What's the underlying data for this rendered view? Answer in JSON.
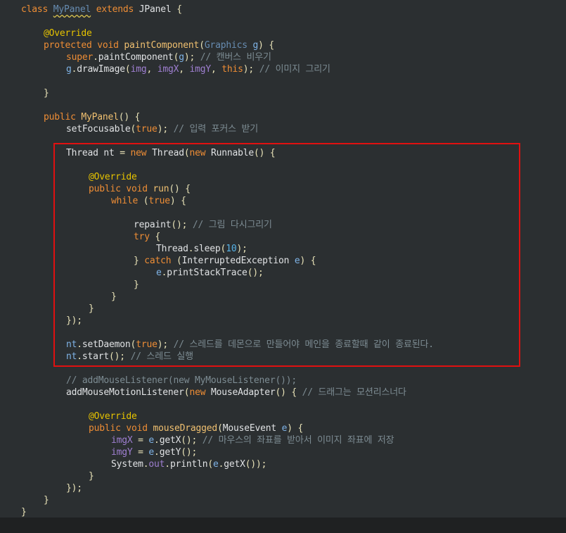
{
  "editor": {
    "lines": [
      {
        "indent": 1,
        "tokens": [
          [
            "kw",
            "class "
          ],
          [
            "ty",
            "MyPanel",
            "squiggle"
          ],
          [
            "kw",
            " extends "
          ],
          [
            "id",
            "JPanel "
          ],
          [
            "pn",
            "{"
          ]
        ]
      },
      {
        "indent": 0,
        "tokens": []
      },
      {
        "indent": 2,
        "tokens": [
          [
            "an",
            "@Override"
          ]
        ]
      },
      {
        "indent": 2,
        "tokens": [
          [
            "kw",
            "protected void "
          ],
          [
            "fn",
            "paintComponent"
          ],
          [
            "pn",
            "("
          ],
          [
            "ty",
            "Graphics "
          ],
          [
            "loc",
            "g"
          ],
          [
            "pn",
            ") {"
          ]
        ]
      },
      {
        "indent": 3,
        "tokens": [
          [
            "kw",
            "super"
          ],
          [
            "pn",
            "."
          ],
          [
            "id",
            "paintComponent"
          ],
          [
            "pn",
            "("
          ],
          [
            "loc",
            "g"
          ],
          [
            "pn",
            ");"
          ],
          [
            "cm",
            " // 캔버스 비우기"
          ]
        ]
      },
      {
        "indent": 3,
        "tokens": [
          [
            "loc",
            "g"
          ],
          [
            "pn",
            "."
          ],
          [
            "id",
            "drawImage"
          ],
          [
            "pn",
            "("
          ],
          [
            "fld",
            "img"
          ],
          [
            "pn",
            ", "
          ],
          [
            "fld",
            "imgX"
          ],
          [
            "pn",
            ", "
          ],
          [
            "fld",
            "imgY"
          ],
          [
            "pn",
            ", "
          ],
          [
            "kw",
            "this"
          ],
          [
            "pn",
            ");"
          ],
          [
            "cm",
            " // 이미지 그리기"
          ]
        ]
      },
      {
        "indent": 0,
        "tokens": []
      },
      {
        "indent": 2,
        "tokens": [
          [
            "pn",
            "}"
          ]
        ]
      },
      {
        "indent": 0,
        "tokens": []
      },
      {
        "indent": 2,
        "tokens": [
          [
            "kw",
            "public "
          ],
          [
            "fn",
            "MyPanel"
          ],
          [
            "pn",
            "() {"
          ]
        ]
      },
      {
        "indent": 3,
        "tokens": [
          [
            "id",
            "setFocusable"
          ],
          [
            "pn",
            "("
          ],
          [
            "kw",
            "true"
          ],
          [
            "pn",
            ");"
          ],
          [
            "cm",
            " // 입력 포커스 받기"
          ]
        ]
      },
      {
        "indent": 0,
        "tokens": []
      },
      {
        "indent": 3,
        "tokens": [
          [
            "id",
            "Thread "
          ],
          [
            "id",
            "nt"
          ],
          [
            "pn",
            " = "
          ],
          [
            "kw",
            "new "
          ],
          [
            "id",
            "Thread"
          ],
          [
            "pn",
            "("
          ],
          [
            "kw",
            "new "
          ],
          [
            "id",
            "Runnable"
          ],
          [
            "pn",
            "() {"
          ]
        ]
      },
      {
        "indent": 0,
        "tokens": []
      },
      {
        "indent": 4,
        "tokens": [
          [
            "an",
            "@Override"
          ]
        ]
      },
      {
        "indent": 4,
        "tokens": [
          [
            "kw",
            "public void "
          ],
          [
            "fn",
            "run"
          ],
          [
            "pn",
            "() {"
          ]
        ]
      },
      {
        "indent": 5,
        "tokens": [
          [
            "kw",
            "while "
          ],
          [
            "pn",
            "("
          ],
          [
            "kw",
            "true"
          ],
          [
            "pn",
            ") {"
          ]
        ]
      },
      {
        "indent": 0,
        "tokens": []
      },
      {
        "indent": 6,
        "tokens": [
          [
            "id",
            "repaint"
          ],
          [
            "pn",
            "();"
          ],
          [
            "cm",
            " // 그림 다시그리기"
          ]
        ]
      },
      {
        "indent": 6,
        "tokens": [
          [
            "kw",
            "try "
          ],
          [
            "pn",
            "{"
          ]
        ]
      },
      {
        "indent": 7,
        "tokens": [
          [
            "id",
            "Thread"
          ],
          [
            "pn",
            "."
          ],
          [
            "id",
            "sleep"
          ],
          [
            "pn",
            "("
          ],
          [
            "num",
            "10"
          ],
          [
            "pn",
            ");"
          ]
        ]
      },
      {
        "indent": 6,
        "tokens": [
          [
            "pn",
            "} "
          ],
          [
            "kw",
            "catch "
          ],
          [
            "pn",
            "("
          ],
          [
            "id",
            "InterruptedException "
          ],
          [
            "loc",
            "e"
          ],
          [
            "pn",
            ") {"
          ]
        ]
      },
      {
        "indent": 7,
        "tokens": [
          [
            "loc",
            "e"
          ],
          [
            "pn",
            "."
          ],
          [
            "id",
            "printStackTrace"
          ],
          [
            "pn",
            "();"
          ]
        ]
      },
      {
        "indent": 6,
        "tokens": [
          [
            "pn",
            "}"
          ]
        ]
      },
      {
        "indent": 5,
        "tokens": [
          [
            "pn",
            "}"
          ]
        ]
      },
      {
        "indent": 4,
        "tokens": [
          [
            "pn",
            "}"
          ]
        ]
      },
      {
        "indent": 3,
        "tokens": [
          [
            "pn",
            "});"
          ]
        ]
      },
      {
        "indent": 0,
        "tokens": []
      },
      {
        "indent": 3,
        "tokens": [
          [
            "loc",
            "nt"
          ],
          [
            "pn",
            "."
          ],
          [
            "id",
            "setDaemon"
          ],
          [
            "pn",
            "("
          ],
          [
            "kw",
            "true"
          ],
          [
            "pn",
            ");"
          ],
          [
            "cm",
            " // 스레드를 데몬으로 만들어야 메인을 종료할때 같이 종료된다."
          ]
        ]
      },
      {
        "indent": 3,
        "tokens": [
          [
            "loc",
            "nt"
          ],
          [
            "pn",
            "."
          ],
          [
            "id",
            "start"
          ],
          [
            "pn",
            "();"
          ],
          [
            "cm",
            " // 스레드 실행"
          ]
        ]
      },
      {
        "indent": 0,
        "tokens": []
      },
      {
        "indent": 3,
        "tokens": [
          [
            "cm",
            "// addMouseListener(new MyMouseListener());"
          ]
        ]
      },
      {
        "indent": 3,
        "tokens": [
          [
            "id",
            "addMouseMotionListener"
          ],
          [
            "pn",
            "("
          ],
          [
            "kw",
            "new "
          ],
          [
            "id",
            "MouseAdapter"
          ],
          [
            "pn",
            "() {"
          ],
          [
            "cm",
            " // 드래그는 모션리스너다"
          ]
        ]
      },
      {
        "indent": 0,
        "tokens": []
      },
      {
        "indent": 4,
        "tokens": [
          [
            "an",
            "@Override"
          ]
        ]
      },
      {
        "indent": 4,
        "tokens": [
          [
            "kw",
            "public void "
          ],
          [
            "fn",
            "mouseDragged"
          ],
          [
            "pn",
            "("
          ],
          [
            "id",
            "MouseEvent "
          ],
          [
            "loc",
            "e"
          ],
          [
            "pn",
            ") {"
          ]
        ]
      },
      {
        "indent": 5,
        "tokens": [
          [
            "fld",
            "imgX"
          ],
          [
            "pn",
            " = "
          ],
          [
            "loc",
            "e"
          ],
          [
            "pn",
            "."
          ],
          [
            "id",
            "getX"
          ],
          [
            "pn",
            "();"
          ],
          [
            "cm",
            " // 마우스의 좌표를 받아서 이미지 좌표에 저장"
          ]
        ]
      },
      {
        "indent": 5,
        "tokens": [
          [
            "fld",
            "imgY"
          ],
          [
            "pn",
            " = "
          ],
          [
            "loc",
            "e"
          ],
          [
            "pn",
            "."
          ],
          [
            "id",
            "getY"
          ],
          [
            "pn",
            "();"
          ]
        ]
      },
      {
        "indent": 5,
        "tokens": [
          [
            "id",
            "System"
          ],
          [
            "pn",
            "."
          ],
          [
            "fld",
            "out"
          ],
          [
            "pn",
            "."
          ],
          [
            "id",
            "println"
          ],
          [
            "pn",
            "("
          ],
          [
            "loc",
            "e"
          ],
          [
            "pn",
            "."
          ],
          [
            "id",
            "getX"
          ],
          [
            "pn",
            "());"
          ]
        ]
      },
      {
        "indent": 4,
        "tokens": [
          [
            "pn",
            "}"
          ]
        ]
      },
      {
        "indent": 3,
        "tokens": [
          [
            "pn",
            "});"
          ]
        ]
      },
      {
        "indent": 2,
        "tokens": [
          [
            "pn",
            "}"
          ]
        ]
      },
      {
        "indent": 1,
        "tokens": [
          [
            "pn",
            "}"
          ]
        ]
      }
    ]
  },
  "highlight": {
    "color": "#e01010",
    "note": ""
  },
  "colors": {
    "background": "#2b2f31",
    "keyword": "#ee8d35",
    "comment": "#7d8c93",
    "annotation": "#e6c300",
    "number": "#57b3e6"
  }
}
